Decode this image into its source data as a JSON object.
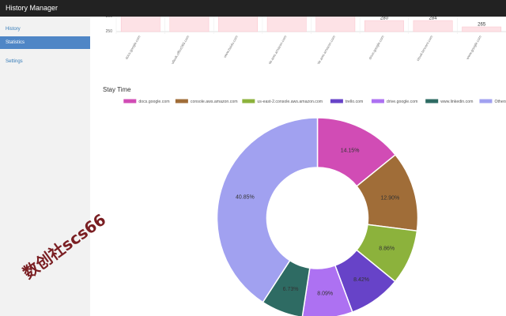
{
  "app": {
    "title": "History Manager"
  },
  "sidebar": {
    "items": [
      {
        "label": "History",
        "active": false
      },
      {
        "label": "Statistics",
        "active": true
      },
      {
        "label": "Settings",
        "active": false
      }
    ]
  },
  "bar_chart": {
    "y_ticks": [
      "300",
      "250"
    ],
    "categories": [
      "docs.google.com",
      "outlook.office365.com",
      "www.baidu.com",
      "console.aws.amazon.com",
      "us-east-2.console.aws.amazon.com",
      "drive.google.com",
      "cloud.tencent.com",
      "www.google.com"
    ],
    "visible_labels": [
      "",
      "",
      "",
      "",
      "",
      "280",
      "284",
      "265"
    ],
    "color": "#fde2e6",
    "border": "#fbc1cb"
  },
  "stay_time": {
    "title": "Stay Time",
    "chart_data": {
      "type": "pie",
      "legend": "top",
      "labels": [
        "docs.google.com",
        "console.aws.amazon.com",
        "us-east-2.console.aws.amazon.com",
        "trello.com",
        "drive.google.com",
        "www.linkedin.com",
        "Others"
      ],
      "values": [
        14.15,
        12.9,
        8.86,
        8.42,
        8.09,
        6.73,
        40.85
      ],
      "value_labels": [
        "14.15%",
        "12.90%",
        "8.86%",
        "8.42%",
        "8.09%",
        "6.73%",
        "40.85%"
      ],
      "colors": [
        "#d14cb5",
        "#a06d38",
        "#8cb23c",
        "#6743c8",
        "#ad71f2",
        "#2e6b63",
        "#a1a1f0"
      ]
    }
  },
  "watermark": {
    "text": "数创社scs66"
  }
}
